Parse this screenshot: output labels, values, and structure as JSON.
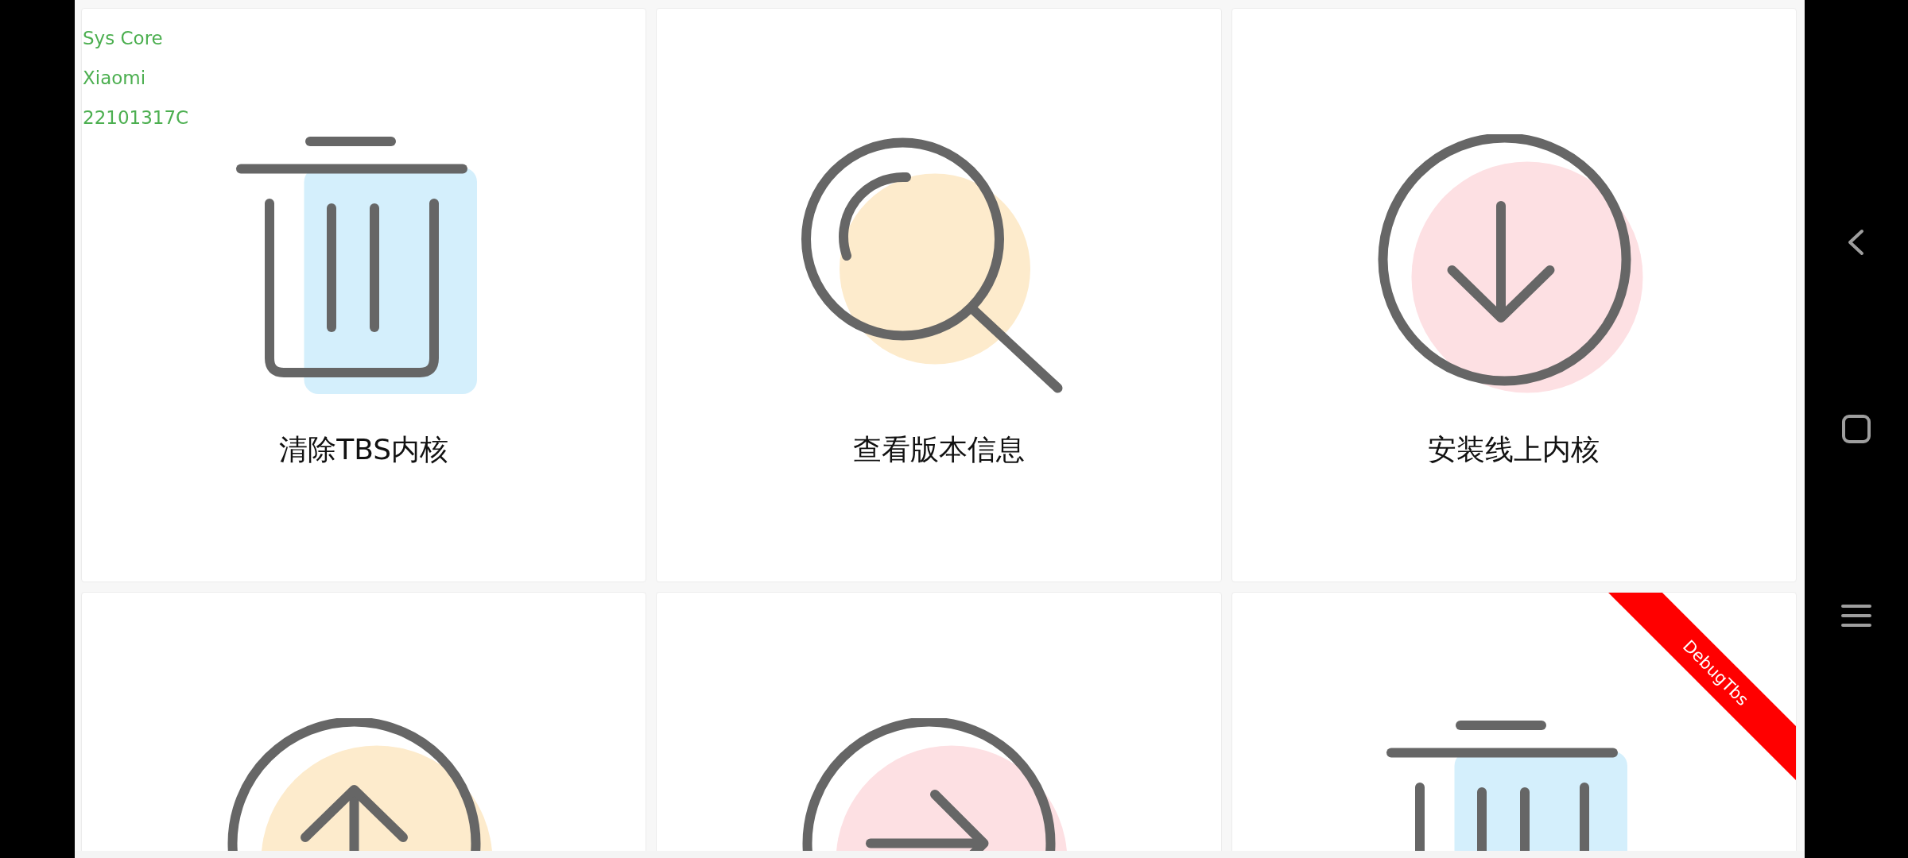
{
  "device_info": [
    "Sys Core",
    "Xiaomi",
    "22101317C"
  ],
  "ribbon": {
    "label": "DebugTbs"
  },
  "actions": [
    {
      "kind": "trash",
      "label": "清除TBS内核"
    },
    {
      "kind": "search",
      "label": "查看版本信息"
    },
    {
      "kind": "download",
      "label": "安装线上内核"
    },
    {
      "kind": "upload"
    },
    {
      "kind": "arrow"
    },
    {
      "kind": "trash"
    }
  ]
}
